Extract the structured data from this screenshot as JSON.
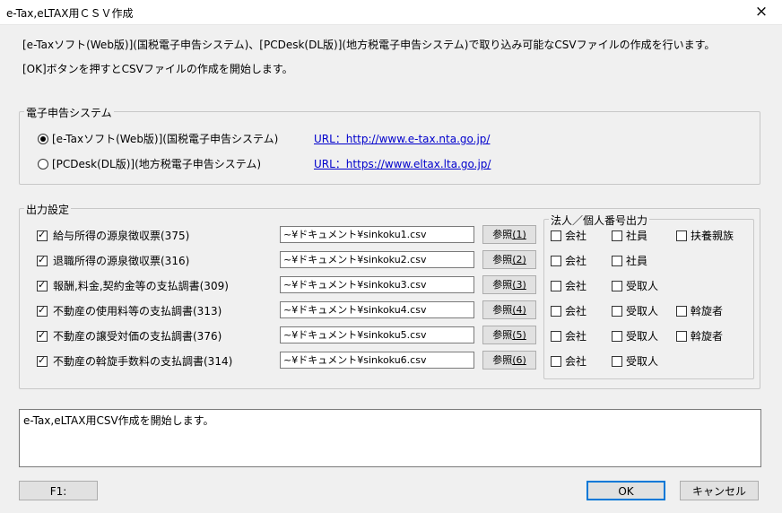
{
  "window": {
    "title": "e-Tax,eLTAX用ＣＳＶ作成",
    "close": "×"
  },
  "description": {
    "line1": "[e-Taxソフト(Web版)](国税電子申告システム)、[PCDesk(DL版)](地方税電子申告システム)で取り込み可能なCSVファイルの作成を行います。",
    "line2": "[OK]ボタンを押すとCSVファイルの作成を開始します。"
  },
  "system_group": {
    "label": "電子申告システム",
    "options": [
      {
        "label": "[e-Taxソフト(Web版)](国税電子申告システム)",
        "selected": true,
        "url": "URL：http://www.e-tax.nta.go.jp/"
      },
      {
        "label": "[PCDesk(DL版)](地方税電子申告システム)",
        "selected": false,
        "url": "URL：https://www.eltax.lta.go.jp/"
      }
    ]
  },
  "output_group": {
    "label": "出力設定",
    "number_group_label": "法人／個人番号出力",
    "rows": [
      {
        "label": "給与所得の源泉徴収票(375)",
        "checked": true,
        "path": "~¥ドキュメント¥sinkoku1.csv",
        "ref_text": "参照",
        "ref_key": "(1)",
        "options": [
          {
            "label": "会社",
            "checked": false
          },
          {
            "label": "社員",
            "checked": false
          },
          {
            "label": "扶養親族",
            "checked": false
          }
        ]
      },
      {
        "label": "退職所得の源泉徴収票(316)",
        "checked": true,
        "path": "~¥ドキュメント¥sinkoku2.csv",
        "ref_text": "参照",
        "ref_key": "(2)",
        "options": [
          {
            "label": "会社",
            "checked": false
          },
          {
            "label": "社員",
            "checked": false
          }
        ]
      },
      {
        "label": "報酬,料金,契約金等の支払調書(309)",
        "checked": true,
        "path": "~¥ドキュメント¥sinkoku3.csv",
        "ref_text": "参照",
        "ref_key": "(3)",
        "options": [
          {
            "label": "会社",
            "checked": false
          },
          {
            "label": "受取人",
            "checked": false
          }
        ]
      },
      {
        "label": "不動産の使用料等の支払調書(313)",
        "checked": true,
        "path": "~¥ドキュメント¥sinkoku4.csv",
        "ref_text": "参照",
        "ref_key": "(4)",
        "options": [
          {
            "label": "会社",
            "checked": false
          },
          {
            "label": "受取人",
            "checked": false
          },
          {
            "label": "斡旋者",
            "checked": false
          }
        ]
      },
      {
        "label": "不動産の譲受対価の支払調書(376)",
        "checked": true,
        "path": "~¥ドキュメント¥sinkoku5.csv",
        "ref_text": "参照",
        "ref_key": "(5)",
        "options": [
          {
            "label": "会社",
            "checked": false
          },
          {
            "label": "受取人",
            "checked": false
          },
          {
            "label": "斡旋者",
            "checked": false
          }
        ]
      },
      {
        "label": "不動産の斡旋手数料の支払調書(314)",
        "checked": true,
        "path": "~¥ドキュメント¥sinkoku6.csv",
        "ref_text": "参照",
        "ref_key": "(6)",
        "options": [
          {
            "label": "会社",
            "checked": false
          },
          {
            "label": "受取人",
            "checked": false
          }
        ]
      }
    ]
  },
  "status": {
    "message": "e-Tax,eLTAX用CSV作成を開始します。"
  },
  "buttons": {
    "f1": "F1:",
    "ok": "OK",
    "cancel": "キャンセル"
  },
  "colors": {
    "background": "#f0f0f0",
    "link": "#0000cc",
    "default_border": "#0078d7"
  }
}
